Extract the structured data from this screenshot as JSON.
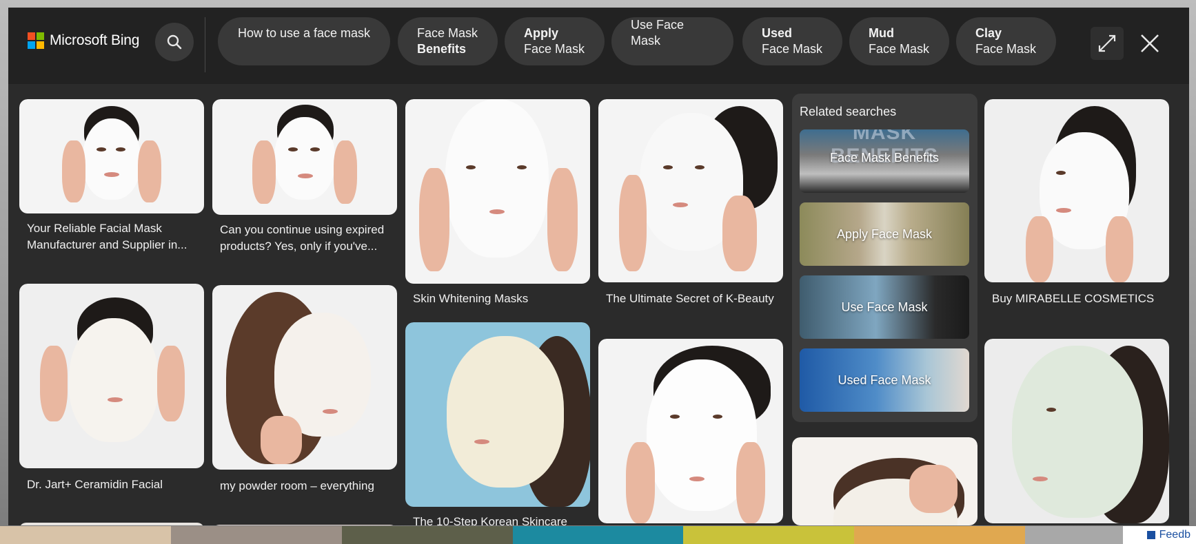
{
  "brand": {
    "name": "Microsoft Bing",
    "logo_colors": [
      "#f25022",
      "#7fba00",
      "#00a4ef",
      "#ffb900"
    ]
  },
  "chips": [
    {
      "line1": "How to use a face mask",
      "line2": "",
      "bold": "none"
    },
    {
      "line1": "Face Mask",
      "line2": "Benefits",
      "bold": "line2"
    },
    {
      "line1": "Apply",
      "line2": "Face Mask",
      "bold": "line1"
    },
    {
      "line1": "Use Face Mask",
      "line2": "",
      "bold": "none"
    },
    {
      "line1": "Used",
      "line2": "Face Mask",
      "bold": "line1"
    },
    {
      "line1": "Mud",
      "line2": "Face Mask",
      "bold": "line1"
    },
    {
      "line1": "Clay",
      "line2": "Face Mask",
      "bold": "line1"
    }
  ],
  "icons": {
    "search": "search-icon",
    "expand": "expand-icon",
    "close": "close-icon"
  },
  "results": {
    "col1": [
      {
        "caption": "Your Reliable Facial Mask Manufacturer and Supplier in..."
      },
      {
        "caption": "Dr. Jart+ Ceramidin Facial Barrier Mask | Facial masks, Mask,..."
      }
    ],
    "col2": [
      {
        "caption": "Can you continue using expired products? Yes, only if you've..."
      },
      {
        "caption": "my powder room – everything you should keep in your powder..."
      }
    ],
    "col3": [
      {
        "caption": "Skin Whitening Masks"
      },
      {
        "caption": "The 10-Step Korean Skincare"
      }
    ],
    "col4": [
      {
        "caption": "The Ultimate Secret of K-Beauty Masks – Keoji"
      }
    ],
    "col6": [
      {
        "caption": "Buy MIRABELLE COSMETICS KOREA Fairness Sheet Facial..."
      }
    ]
  },
  "related": {
    "title": "Related searches",
    "items": [
      {
        "label": "Face Mask Benefits",
        "banner": "MASK BENEFITS"
      },
      {
        "label": "Apply Face Mask"
      },
      {
        "label": "Use Face Mask"
      },
      {
        "label": "Used Face Mask"
      }
    ]
  },
  "footer": {
    "feedback": "Feedb"
  }
}
